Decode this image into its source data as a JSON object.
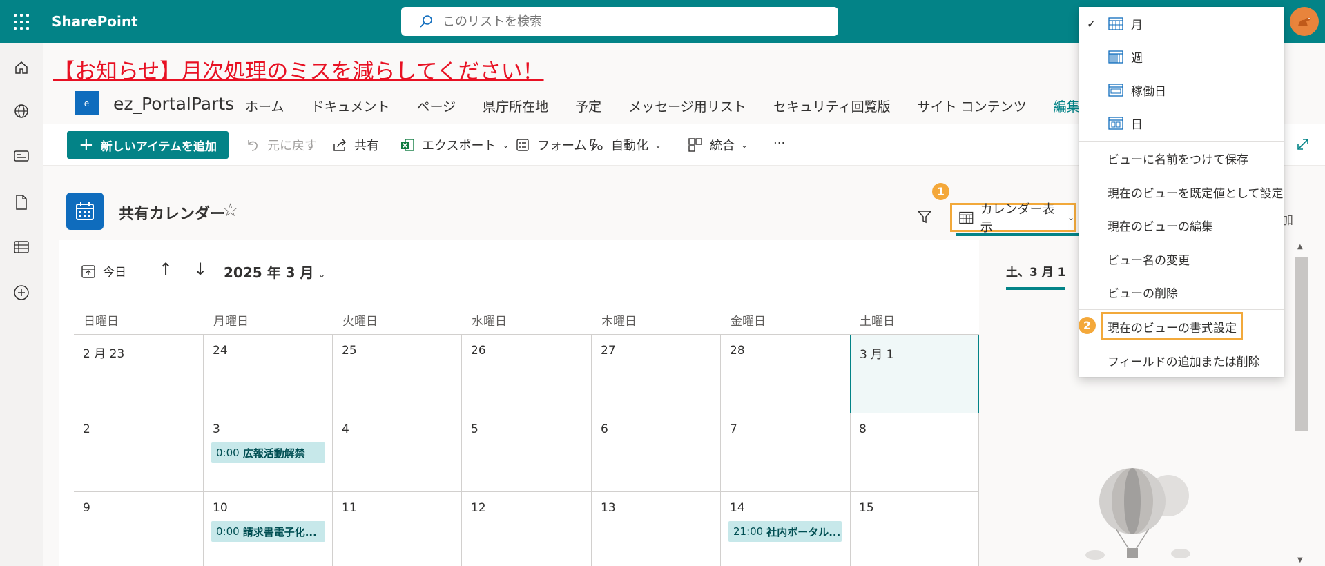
{
  "suite": {
    "brand": "SharePoint",
    "search_placeholder": "このリストを検索"
  },
  "notice": "【お知らせ】月次処理のミスを減らしてください！",
  "site": {
    "logo_letter": "e",
    "title": "ez_PortalParts",
    "nav": [
      "ホーム",
      "ドキュメント",
      "ページ",
      "県庁所在地",
      "予定",
      "メッセージ用リスト",
      "セキュリティ回覧版",
      "サイト コンテンツ",
      "編集"
    ]
  },
  "command_bar": {
    "new_item": "新しいアイテムを追加",
    "undo": "元に戻す",
    "share": "共有",
    "export": "エクスポート",
    "forms": "フォーム",
    "automate": "自動化",
    "integrate": "統合",
    "more": "···"
  },
  "list": {
    "title": "共有カレンダー",
    "view_label": "カレンダー表示",
    "add_column_partial": "加"
  },
  "callouts": {
    "one": "1",
    "two": "2"
  },
  "calendar": {
    "today": "今日",
    "month": "2025 年 3 月",
    "weekdays": [
      "日曜日",
      "月曜日",
      "火曜日",
      "水曜日",
      "木曜日",
      "金曜日",
      "土曜日"
    ],
    "week1": [
      "2 月 23",
      "24",
      "25",
      "26",
      "27",
      "28",
      "3 月 1"
    ],
    "week2": [
      "2",
      "3",
      "4",
      "5",
      "6",
      "7",
      "8"
    ],
    "week3": [
      "9",
      "10",
      "11",
      "12",
      "13",
      "14",
      "15"
    ],
    "events": [
      {
        "time": "0:00",
        "name": "広報活動解禁"
      },
      {
        "time": "0:00",
        "name": "請求書電子化..."
      },
      {
        "time": "21:00",
        "name": "社内ポータル..."
      }
    ]
  },
  "agenda": {
    "day_label": "土、3 月 1"
  },
  "view_menu": {
    "layouts": [
      "月",
      "週",
      "稼働日",
      "日"
    ],
    "actions": [
      "ビューに名前をつけて保存",
      "現在のビューを既定値として設定",
      "現在のビューの編集",
      "ビュー名の変更",
      "ビューの削除"
    ],
    "format": "現在のビューの書式設定",
    "fields": "フィールドの追加または削除"
  },
  "colors": {
    "suite_bar": "#038387",
    "accent": "#038387",
    "notice": "#e81123",
    "highlight": "#f2a93b",
    "event_bg": "#c7e8ea"
  }
}
